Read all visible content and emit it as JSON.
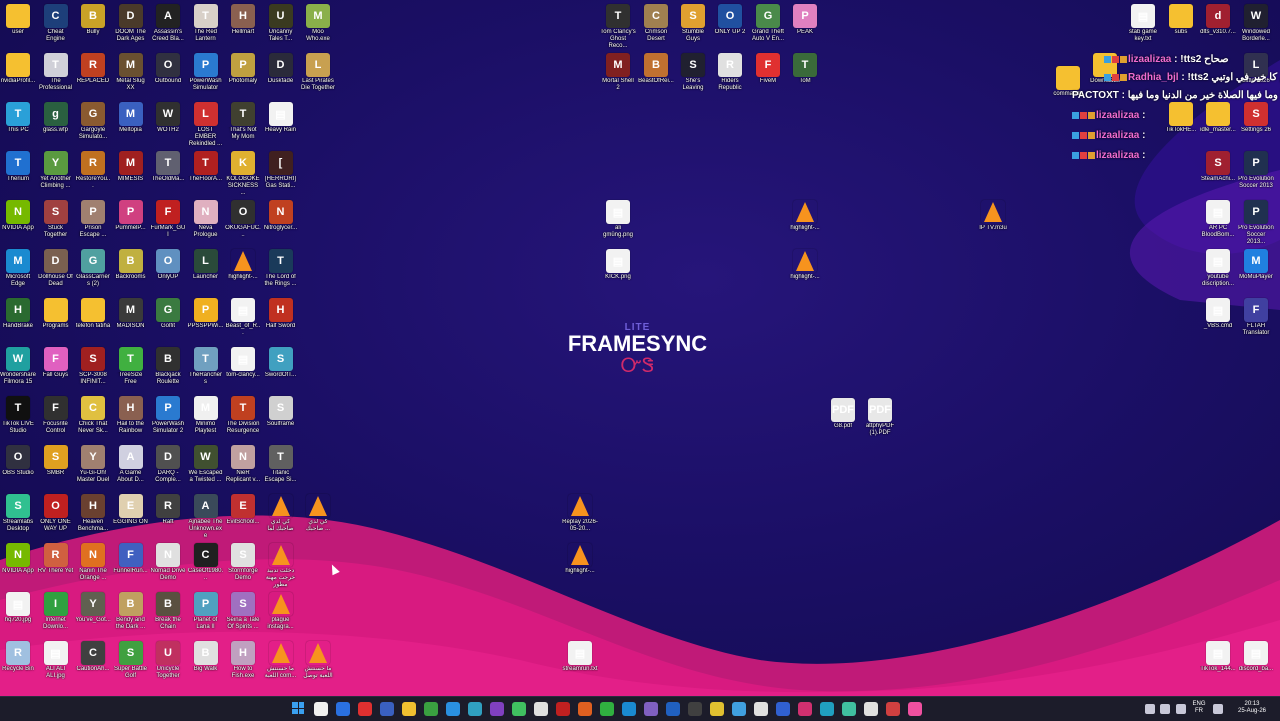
{
  "desktop_icons": [
    {
      "label": "user",
      "type": "folder",
      "col": 0,
      "row": 0
    },
    {
      "label": "Cheat Engine",
      "type": "app",
      "color": "#1d3f7a",
      "col": 1,
      "row": 0
    },
    {
      "label": "Bully",
      "type": "app",
      "color": "#c9a227",
      "col": 2,
      "row": 0
    },
    {
      "label": "DOOM The Dark Ages",
      "type": "app",
      "color": "#4a3a2a",
      "col": 3,
      "row": 0
    },
    {
      "label": "Assassin's Creed Bla...",
      "type": "app",
      "color": "#222",
      "col": 4,
      "row": 0
    },
    {
      "label": "The Red Lantern",
      "type": "app",
      "color": "#d8d0c8",
      "col": 5,
      "row": 0
    },
    {
      "label": "Hellmart",
      "type": "app",
      "color": "#8a6050",
      "col": 6,
      "row": 0
    },
    {
      "label": "Uncanny Tales T...",
      "type": "app",
      "color": "#3a3a20",
      "col": 7,
      "row": 0
    },
    {
      "label": "Moo Who.exe",
      "type": "app",
      "color": "#8ab04a",
      "col": 8,
      "row": 0
    },
    {
      "label": "nvidiaProfil...",
      "type": "folder",
      "col": 0,
      "row": 1
    },
    {
      "label": "The Professional",
      "type": "app",
      "color": "#d0d0d8",
      "col": 1,
      "row": 1
    },
    {
      "label": "REPLACED",
      "type": "app",
      "color": "#c04020",
      "col": 2,
      "row": 1
    },
    {
      "label": "Metal Slug XX",
      "type": "app",
      "color": "#6a5030",
      "col": 3,
      "row": 1
    },
    {
      "label": "Outbound",
      "type": "app",
      "color": "#303040",
      "col": 4,
      "row": 1
    },
    {
      "label": "PowerWash Simulator",
      "type": "app",
      "color": "#2a7ad0",
      "col": 5,
      "row": 1
    },
    {
      "label": "Photomaly",
      "type": "app",
      "color": "#c0a040",
      "col": 6,
      "row": 1
    },
    {
      "label": "Duskfade",
      "type": "app",
      "color": "#2a2a3a",
      "col": 7,
      "row": 1
    },
    {
      "label": "Last Pirates Die Together",
      "type": "app",
      "color": "#c8a050",
      "col": 8,
      "row": 1
    },
    {
      "label": "This PC",
      "type": "app",
      "color": "#2aa0d8",
      "col": 0,
      "row": 2
    },
    {
      "label": "glass.wfp",
      "type": "app",
      "color": "#2a6040",
      "col": 1,
      "row": 2
    },
    {
      "label": "Gargoyle Simulato...",
      "type": "app",
      "color": "#8a5a30",
      "col": 2,
      "row": 2
    },
    {
      "label": "Meltopia",
      "type": "app",
      "color": "#3a60c0",
      "col": 3,
      "row": 2
    },
    {
      "label": "WOTH2",
      "type": "app",
      "color": "#303030",
      "col": 4,
      "row": 2
    },
    {
      "label": "LOST EMBER Rekindled ...",
      "type": "app",
      "color": "#d03030",
      "col": 5,
      "row": 2
    },
    {
      "label": "That's Not My Mom",
      "type": "app",
      "color": "#404030",
      "col": 6,
      "row": 2
    },
    {
      "label": "Heavy Rain",
      "type": "file",
      "col": 7,
      "row": 2
    },
    {
      "label": "Therium",
      "type": "app",
      "color": "#2070d0",
      "col": 0,
      "row": 3
    },
    {
      "label": "Yet Another Climbing ...",
      "type": "app",
      "color": "#5a9a40",
      "col": 1,
      "row": 3
    },
    {
      "label": "RestoreYou...",
      "type": "app",
      "color": "#c07020",
      "col": 2,
      "row": 3
    },
    {
      "label": "MIMESIS",
      "type": "app",
      "color": "#a02020",
      "col": 3,
      "row": 3
    },
    {
      "label": "TheOldMa...",
      "type": "app",
      "color": "#606070",
      "col": 4,
      "row": 3
    },
    {
      "label": "TheFloorA...",
      "type": "app",
      "color": "#b02020",
      "col": 5,
      "row": 3
    },
    {
      "label": "KOLOBOKE SICKNESS ...",
      "type": "app",
      "color": "#e0b030",
      "col": 6,
      "row": 3
    },
    {
      "label": "[HERRORI] Gas Stati...",
      "type": "app",
      "color": "#402020",
      "col": 7,
      "row": 3
    },
    {
      "label": "NVIDIA App",
      "type": "app",
      "color": "#76b900",
      "col": 0,
      "row": 4
    },
    {
      "label": "Stuck Together",
      "type": "app",
      "color": "#a04040",
      "col": 1,
      "row": 4
    },
    {
      "label": "Prison Escape ...",
      "type": "app",
      "color": "#a08070",
      "col": 2,
      "row": 4
    },
    {
      "label": "PummelP...",
      "type": "app",
      "color": "#d04080",
      "col": 3,
      "row": 4
    },
    {
      "label": "FurMark_GUI",
      "type": "app",
      "color": "#c02020",
      "col": 4,
      "row": 4
    },
    {
      "label": "Neva Prologue",
      "type": "app",
      "color": "#e0b0c0",
      "col": 5,
      "row": 4
    },
    {
      "label": "OKUGAFUC...",
      "type": "app",
      "color": "#303030",
      "col": 6,
      "row": 4
    },
    {
      "label": "Nitroglycer...",
      "type": "app",
      "color": "#c04020",
      "col": 7,
      "row": 4
    },
    {
      "label": "Microsoft Edge",
      "type": "app",
      "color": "#1a8ad0",
      "col": 0,
      "row": 5
    },
    {
      "label": "Dollhouse Of Dead",
      "type": "app",
      "color": "#7a6050",
      "col": 1,
      "row": 5
    },
    {
      "label": "GlassCarriers (2)",
      "type": "app",
      "color": "#50a0a0",
      "col": 2,
      "row": 5
    },
    {
      "label": "Backrooms",
      "type": "app",
      "color": "#c0b040",
      "col": 3,
      "row": 5
    },
    {
      "label": "OnlyUP",
      "type": "app",
      "color": "#6090c0",
      "col": 4,
      "row": 5
    },
    {
      "label": "Launcher",
      "type": "app",
      "color": "#2a4a3a",
      "col": 5,
      "row": 5
    },
    {
      "label": "highlight-...",
      "type": "vlc",
      "col": 6,
      "row": 5
    },
    {
      "label": "The Lord of the Rings ...",
      "type": "app",
      "color": "#1a3a5a",
      "col": 7,
      "row": 5
    },
    {
      "label": "HandBrake",
      "type": "app",
      "color": "#2a6a30",
      "col": 0,
      "row": 6
    },
    {
      "label": "Programs",
      "type": "folder",
      "col": 1,
      "row": 6
    },
    {
      "label": "telefon fatiha",
      "type": "folder",
      "col": 2,
      "row": 6
    },
    {
      "label": "MADISON",
      "type": "app",
      "color": "#3a3a3a",
      "col": 3,
      "row": 6
    },
    {
      "label": "Golfit",
      "type": "app",
      "color": "#3a7a40",
      "col": 4,
      "row": 6
    },
    {
      "label": "PPSSPPWi...",
      "type": "app",
      "color": "#f0b020",
      "col": 5,
      "row": 6
    },
    {
      "label": "Beast_of_R...",
      "type": "file",
      "col": 6,
      "row": 6
    },
    {
      "label": "Half Sword",
      "type": "app",
      "color": "#c03020",
      "col": 7,
      "row": 6
    },
    {
      "label": "Wondershare Filmora 15",
      "type": "app",
      "color": "#20a0a0",
      "col": 0,
      "row": 7
    },
    {
      "label": "Fall Guys",
      "type": "app",
      "color": "#e060c0",
      "col": 1,
      "row": 7
    },
    {
      "label": "SCP-3008 INFINIT...",
      "type": "app",
      "color": "#a02020",
      "col": 2,
      "row": 7
    },
    {
      "label": "TreeSize Free",
      "type": "app",
      "color": "#40b040",
      "col": 3,
      "row": 7
    },
    {
      "label": "Blackjack Roulette",
      "type": "app",
      "color": "#303030",
      "col": 4,
      "row": 7
    },
    {
      "label": "TheRanchers",
      "type": "app",
      "color": "#70a0c0",
      "col": 5,
      "row": 7
    },
    {
      "label": "tom-clancy...",
      "type": "file",
      "col": 6,
      "row": 7
    },
    {
      "label": "SwordOfT...",
      "type": "app",
      "color": "#40a0c0",
      "col": 7,
      "row": 7
    },
    {
      "label": "TikTok LIVE Studio",
      "type": "app",
      "color": "#101010",
      "col": 0,
      "row": 8
    },
    {
      "label": "Focusrite Control",
      "type": "app",
      "color": "#303030",
      "col": 1,
      "row": 8
    },
    {
      "label": "Chick That Never Sk...",
      "type": "app",
      "color": "#e0c040",
      "col": 2,
      "row": 8
    },
    {
      "label": "Hail to the Rainbow",
      "type": "app",
      "color": "#8a6050",
      "col": 3,
      "row": 8
    },
    {
      "label": "PowerWash Simulator 2",
      "type": "app",
      "color": "#2a7ad0",
      "col": 4,
      "row": 8
    },
    {
      "label": "Minimo Playtest",
      "type": "app",
      "color": "#f0f0f0",
      "col": 5,
      "row": 8
    },
    {
      "label": "The Division Resurgence",
      "type": "app",
      "color": "#c04020",
      "col": 6,
      "row": 8
    },
    {
      "label": "Soulframe",
      "type": "app",
      "color": "#d0d0d0",
      "col": 7,
      "row": 8
    },
    {
      "label": "OBS Studio",
      "type": "app",
      "color": "#303040",
      "col": 0,
      "row": 9
    },
    {
      "label": "SMBR",
      "type": "app",
      "color": "#e0a020",
      "col": 1,
      "row": 9
    },
    {
      "label": "Yu-Gi-Oh! Master Duel",
      "type": "app",
      "color": "#a08070",
      "col": 2,
      "row": 9
    },
    {
      "label": "A Game About D...",
      "type": "app",
      "color": "#d0d0e0",
      "col": 3,
      "row": 9
    },
    {
      "label": "DARQ - Comple...",
      "type": "app",
      "color": "#505050",
      "col": 4,
      "row": 9
    },
    {
      "label": "We Escaped a Twisted ...",
      "type": "app",
      "color": "#405030",
      "col": 5,
      "row": 9
    },
    {
      "label": "NieR Replicant v...",
      "type": "app",
      "color": "#c0a0a0",
      "col": 6,
      "row": 9
    },
    {
      "label": "Titanic Escape Si...",
      "type": "app",
      "color": "#606060",
      "col": 7,
      "row": 9
    },
    {
      "label": "Streamlabs Desktop",
      "type": "app",
      "color": "#30c090",
      "col": 0,
      "row": 10
    },
    {
      "label": "ONLY ONE WAY UP",
      "type": "app",
      "color": "#c02020",
      "col": 1,
      "row": 10
    },
    {
      "label": "Heaven Benchma...",
      "type": "app",
      "color": "#6a4030",
      "col": 2,
      "row": 10
    },
    {
      "label": "EGGING ON",
      "type": "app",
      "color": "#e0d0b0",
      "col": 3,
      "row": 10
    },
    {
      "label": "Raft",
      "type": "app",
      "color": "#404040",
      "col": 4,
      "row": 10
    },
    {
      "label": "Ajnabee The Unknown.exe",
      "type": "app",
      "color": "#3a4a5a",
      "col": 5,
      "row": 10
    },
    {
      "label": "EvilSchool...",
      "type": "app",
      "color": "#c03030",
      "col": 6,
      "row": 10
    },
    {
      "label": "كي لدي صاحبك لما",
      "type": "vlc",
      "col": 7,
      "row": 10
    },
    {
      "label": "كي لدي صاحبك ...",
      "type": "vlc",
      "col": 8,
      "row": 10
    },
    {
      "label": "NVIDIA App",
      "type": "app",
      "color": "#76b900",
      "col": 0,
      "row": 11
    },
    {
      "label": "RV There Yet",
      "type": "app",
      "color": "#d06040",
      "col": 1,
      "row": 11
    },
    {
      "label": "Nanin The Orange ...",
      "type": "app",
      "color": "#e07020",
      "col": 2,
      "row": 11
    },
    {
      "label": "FunnelRun...",
      "type": "app",
      "color": "#4060c0",
      "col": 3,
      "row": 11
    },
    {
      "label": "Nomad Drive Demo",
      "type": "app",
      "color": "#e0e0e0",
      "col": 4,
      "row": 11
    },
    {
      "label": "CaseOf1980...",
      "type": "app",
      "color": "#202020",
      "col": 5,
      "row": 11
    },
    {
      "label": "Stormforge Demo",
      "type": "app",
      "color": "#e0e0e0",
      "col": 6,
      "row": 11
    },
    {
      "label": "دخلت تدبيد خرجت مهنة مطور",
      "type": "vlc",
      "col": 7,
      "row": 11
    },
    {
      "label": "hq720.jpg",
      "type": "file",
      "col": 0,
      "row": 12
    },
    {
      "label": "Internet Downlo...",
      "type": "app",
      "color": "#30a040",
      "col": 1,
      "row": 12
    },
    {
      "label": "You've_Got...",
      "type": "app",
      "color": "#606050",
      "col": 2,
      "row": 12
    },
    {
      "label": "Bendy and the Dark ...",
      "type": "app",
      "color": "#c0a060",
      "col": 3,
      "row": 12
    },
    {
      "label": "Break the Chain",
      "type": "app",
      "color": "#5a5040",
      "col": 4,
      "row": 12
    },
    {
      "label": "Planet of Lana II",
      "type": "app",
      "color": "#50a0c0",
      "col": 5,
      "row": 12
    },
    {
      "label": "Seina a Tale Of Spirits ...",
      "type": "app",
      "color": "#a070c0",
      "col": 6,
      "row": 12
    },
    {
      "label": "plague instagra...",
      "type": "vlc",
      "col": 7,
      "row": 12
    },
    {
      "label": "Recycle Bin",
      "type": "app",
      "color": "#a0c0e0",
      "col": 0,
      "row": 13
    },
    {
      "label": "ALI ALI ALI.jpg",
      "type": "file",
      "col": 1,
      "row": 13
    },
    {
      "label": "CautionAh...",
      "type": "app",
      "color": "#404040",
      "col": 2,
      "row": 13
    },
    {
      "label": "Super Battle Golf",
      "type": "app",
      "color": "#40a040",
      "col": 3,
      "row": 13
    },
    {
      "label": "Unicycle Together",
      "type": "app",
      "color": "#c03060",
      "col": 4,
      "row": 13
    },
    {
      "label": "Big Walk",
      "type": "app",
      "color": "#e0e0e0",
      "col": 5,
      "row": 13
    },
    {
      "label": "How to Fish.exe",
      "type": "app",
      "color": "#c0a0c0",
      "col": 6,
      "row": 13
    },
    {
      "label": "ما حسنتش اللعبة com...",
      "type": "vlc",
      "col": 7,
      "row": 13
    },
    {
      "label": "ما حسنتش اللعبة توصل",
      "type": "vlc",
      "col": 8,
      "row": 13
    }
  ],
  "middle_icons": [
    {
      "label": "Tom Clancy's Ghost Reco...",
      "type": "app",
      "color": "#303030"
    },
    {
      "label": "Crimson Desert",
      "type": "app",
      "color": "#a08050"
    },
    {
      "label": "Stumble Guys",
      "type": "app",
      "color": "#e0a030"
    },
    {
      "label": "ONLY UP 2",
      "type": "app",
      "color": "#2050a0"
    },
    {
      "label": "Grand Theft Auto V En...",
      "type": "app",
      "color": "#4a8a4a"
    },
    {
      "label": "PEAK",
      "type": "app",
      "color": "#e080c0"
    },
    {
      "label": "Mortal Shell 2",
      "type": "app",
      "color": "#802020"
    },
    {
      "label": "BeastOfRei...",
      "type": "app",
      "color": "#c07030"
    },
    {
      "label": "She's Leaving",
      "type": "app",
      "color": "#202030"
    },
    {
      "label": "Riders Republic",
      "type": "app",
      "color": "#e0e0e0"
    },
    {
      "label": "FiveM",
      "type": "app",
      "color": "#e03030"
    },
    {
      "label": "ToM",
      "type": "app",
      "color": "#3a6a3a"
    },
    {
      "label": "ali gmüng.png",
      "type": "file"
    },
    {
      "label": "highlight-...",
      "type": "vlc"
    },
    {
      "label": "IP TV.m3u",
      "type": "vlc"
    },
    {
      "label": "KICK.png",
      "type": "file"
    },
    {
      "label": "highlight-...",
      "type": "vlc"
    },
    {
      "label": "G8.pdf",
      "type": "pdf"
    },
    {
      "label": "attphyPDF (1).PDF",
      "type": "pdf"
    },
    {
      "label": "Replay 2026-05-20...",
      "type": "vlc"
    },
    {
      "label": "highlight-...",
      "type": "vlc"
    },
    {
      "label": "streamrun.txt",
      "type": "file"
    }
  ],
  "right_icons": [
    {
      "label": "stab game key.txt",
      "type": "file"
    },
    {
      "label": "subs",
      "type": "folder"
    },
    {
      "label": "dlts_v310.7...",
      "type": "app",
      "color": "#a02030"
    },
    {
      "label": "Windowed Borderle...",
      "type": "app",
      "color": "#202030"
    },
    {
      "label": "Downloads",
      "type": "folder"
    },
    {
      "label": "commands",
      "type": "folder"
    },
    {
      "label": "Little 2026",
      "type": "app",
      "color": "#303050"
    },
    {
      "label": "TikTokHE...",
      "type": "folder"
    },
    {
      "label": "idle_master...",
      "type": "folder"
    },
    {
      "label": "Settings 26",
      "type": "app",
      "color": "#d03030"
    },
    {
      "label": "SteamAchi...",
      "type": "app",
      "color": "#a02030"
    },
    {
      "label": "Pro Evolution Soccer 2013",
      "type": "app",
      "color": "#203050"
    },
    {
      "label": "AR PC BloodBom...",
      "type": "file"
    },
    {
      "label": "Pro Evolution Soccer 2013...",
      "type": "app",
      "color": "#203050"
    },
    {
      "label": "youtube discription...",
      "type": "file"
    },
    {
      "label": "MoMuPlayer",
      "type": "app",
      "color": "#2080e0"
    },
    {
      "label": "_VBS.cmd",
      "type": "file"
    },
    {
      "label": "FLTAH Translator",
      "type": "app",
      "color": "#4040a0"
    },
    {
      "label": "TikTok_144...",
      "type": "file"
    },
    {
      "label": "discord_ba...",
      "type": "file"
    }
  ],
  "framesync": {
    "lite": "LITE",
    "name": "FRAMESYNC",
    "logo": "ᏅᏕ"
  },
  "chat": [
    {
      "name": "lizaalizaa",
      "msg": ": !tts2 صحاح"
    },
    {
      "name": "Radhia_bjl",
      "msg": ": !tts2 اش كا خير في اوتبي"
    },
    {
      "name": "PACTOXT",
      "msg": ": الذنيا وما فيها الصلاة خير من الدنيا وما فيها"
    },
    {
      "name": "lizaalizaa",
      "msg": ":"
    },
    {
      "name": "lizaalizaa",
      "msg": ":"
    },
    {
      "name": "lizaalizaa",
      "msg": ":"
    }
  ],
  "taskbar": {
    "language": "ENG",
    "region": "FR",
    "time": "20:13",
    "date": "25-Aug-26"
  }
}
